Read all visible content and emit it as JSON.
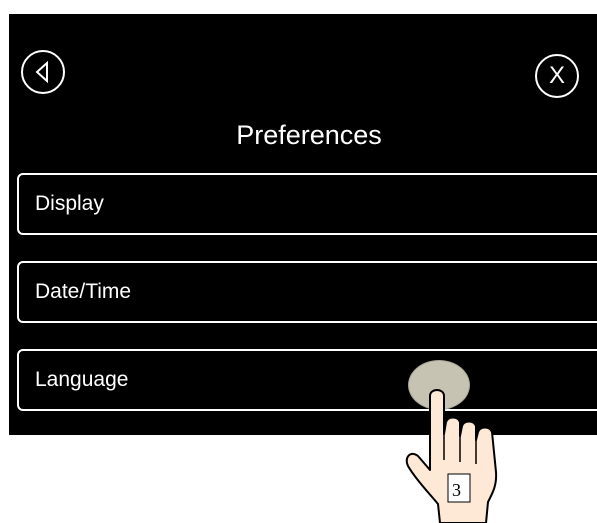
{
  "header": {
    "title": "Preferences",
    "back_icon": "back-triangle-icon",
    "close_label": "X"
  },
  "menu": {
    "items": [
      {
        "label": "Display"
      },
      {
        "label": "Date/Time"
      },
      {
        "label": "Language"
      }
    ]
  },
  "overlay": {
    "step_number": "3",
    "hand_icon": "pointing-hand-icon"
  },
  "colors": {
    "screen_background": "#000000",
    "foreground": "#ffffff",
    "touch_dot": "#c6c3b3",
    "hand_fill": "#fde9d6"
  }
}
